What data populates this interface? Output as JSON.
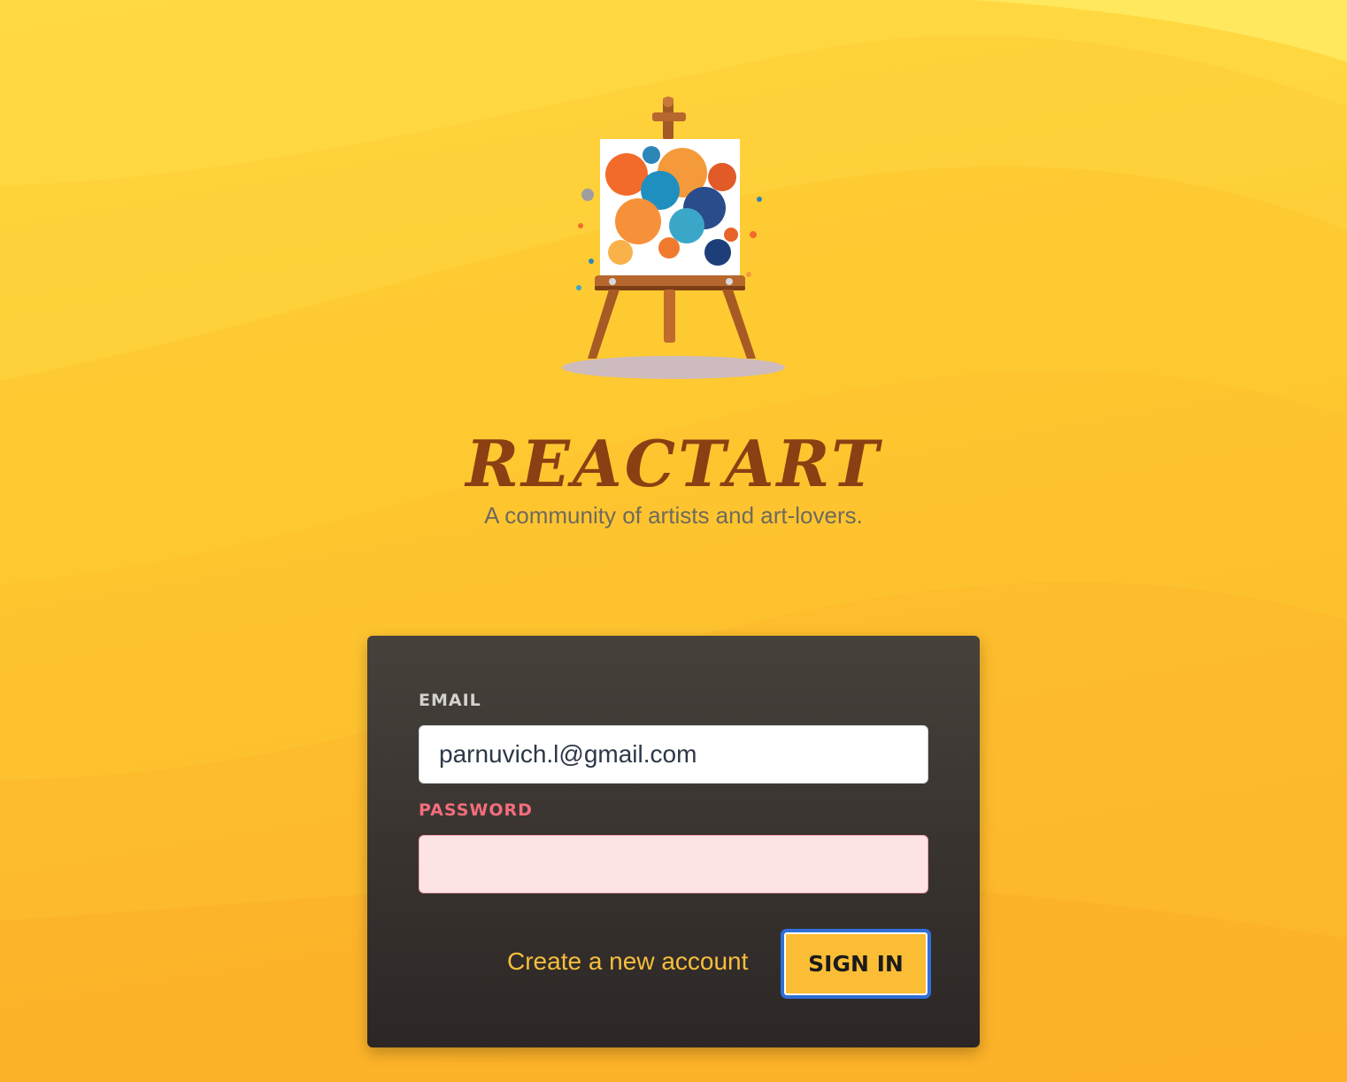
{
  "brand": {
    "title": "REACTART",
    "subtitle": "A community of artists and art-lovers.",
    "logo_icon": "easel-painting-icon"
  },
  "login_form": {
    "email_label": "EMAIL",
    "email_value": "parnuvich.l@gmail.com",
    "password_label": "PASSWORD",
    "password_value": "",
    "create_account_label": "Create a new account",
    "sign_in_label": "SIGN IN"
  },
  "colors": {
    "background": "#fec62f",
    "title": "#8b3f12",
    "card": "#3a3532",
    "password_label_error": "#f36d7c",
    "password_field_error": "#fee3e5",
    "link": "#f7be3d",
    "button": "#fbbd35",
    "button_focus_ring": "#2f6fd6"
  }
}
